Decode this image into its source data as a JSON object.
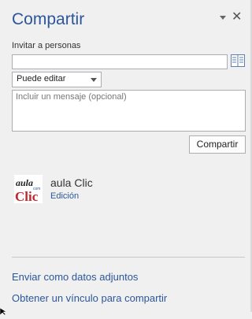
{
  "pane": {
    "title": "Compartir",
    "dropdown_icon": "chevron-down-icon",
    "close_icon": "close-icon"
  },
  "invite": {
    "label": "Invitar a personas",
    "value": "",
    "address_book_icon": "address-book-icon"
  },
  "permission": {
    "selected": "Puede editar"
  },
  "message": {
    "placeholder": "Incluir un mensaje (opcional)"
  },
  "share_button": "Compartir",
  "user": {
    "logo_text_top": "aula",
    "logo_text_small": "com",
    "logo_text_bottom": "Clic",
    "name": "aula Clic",
    "permission": "Edición"
  },
  "links": {
    "attach": "Enviar como datos adjuntos",
    "get_link": "Obtener un vínculo para compartir"
  },
  "colors": {
    "accent": "#2b579a",
    "logo_red": "#c0282d"
  }
}
